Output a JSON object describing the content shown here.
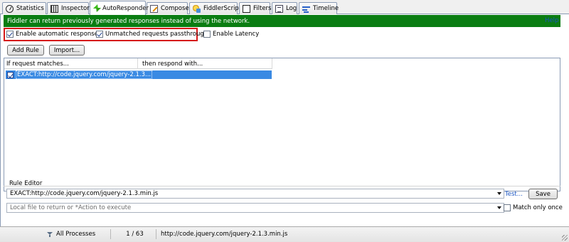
{
  "tabs": [
    {
      "label": "Statistics",
      "icon": "stopwatch-icon"
    },
    {
      "label": "Inspectors",
      "icon": "inspectors-icon"
    },
    {
      "label": "AutoResponder",
      "icon": "lightning-icon",
      "active": true
    },
    {
      "label": "Composer",
      "icon": "composer-icon"
    },
    {
      "label": "FiddlerScript",
      "icon": "script-icon"
    },
    {
      "label": "Filters",
      "icon": "filter-checkbox-icon"
    },
    {
      "label": "Log",
      "icon": "log-icon"
    },
    {
      "label": "Timeline",
      "icon": "timeline-icon"
    }
  ],
  "banner": {
    "text": "Fiddler can return previously generated responses instead of using the network.",
    "help": "Help",
    "color": "#0a7d12"
  },
  "options": {
    "enable_auto": {
      "label": "Enable automatic responses",
      "checked": true
    },
    "unmatched": {
      "label": "Unmatched requests passthrough",
      "checked": true
    },
    "latency": {
      "label": "Enable Latency",
      "checked": false
    }
  },
  "buttons": {
    "add_rule": "Add Rule",
    "import": "Import..."
  },
  "rules": {
    "columns": [
      "If request matches...",
      "then respond with..."
    ],
    "rows": [
      {
        "match": "EXACT:http://code.jquery.com/jquery-2.1.3...",
        "respond": "",
        "checked": true,
        "selected": true
      }
    ]
  },
  "editor": {
    "label": "Rule Editor",
    "match_value": "EXACT:http://code.jquery.com/jquery-2.1.3.min.js",
    "action_placeholder": "Local file to return or *Action to execute",
    "test": "Test...",
    "save": "Save",
    "match_only_once": {
      "label": "Match only once",
      "checked": false
    }
  },
  "status": {
    "processes": "All Processes",
    "count": "1 / 63",
    "url": "http://code.jquery.com/jquery-2.1.3.min.js"
  }
}
